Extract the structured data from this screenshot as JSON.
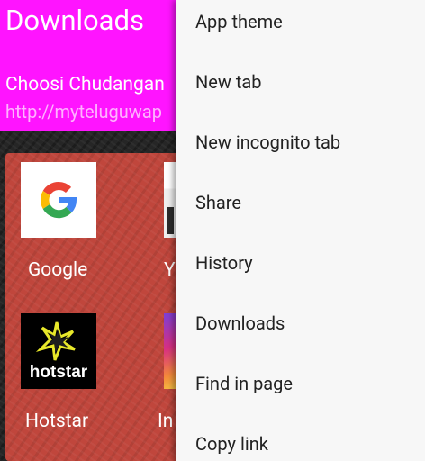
{
  "header": {
    "title": "Downloads",
    "item_name": "Choosi Chudangan",
    "item_url": "http://myteluguwap"
  },
  "speed_dial": [
    {
      "label": "Google",
      "icon": "google-logo"
    },
    {
      "label": "Y",
      "icon": "partial-tile"
    },
    {
      "label": "Hotstar",
      "icon": "hotstar-logo"
    },
    {
      "label": "In",
      "icon": "instagram-partial-tile"
    }
  ],
  "menu": {
    "items": [
      {
        "label": "App theme"
      },
      {
        "label": "New tab"
      },
      {
        "label": "New incognito tab"
      },
      {
        "label": "Share"
      },
      {
        "label": "History"
      },
      {
        "label": "Downloads"
      },
      {
        "label": "Find in page"
      },
      {
        "label": "Copy link"
      }
    ]
  },
  "colors": {
    "header_bg": "#ff14ff",
    "panel_bg": "#c0463c",
    "menu_bg": "#f7f7f7",
    "menu_text": "#222222"
  }
}
